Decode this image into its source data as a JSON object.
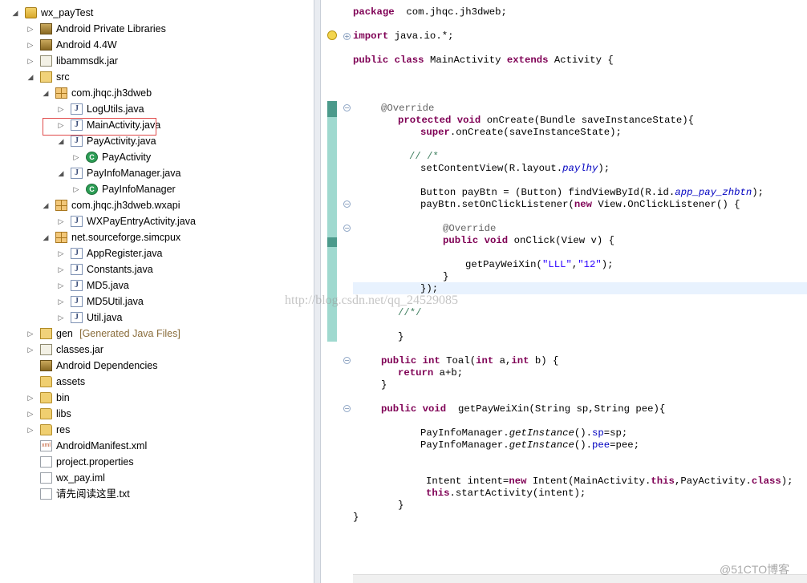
{
  "tree": {
    "items": [
      {
        "label": "wx_payTest",
        "suffix": "",
        "icon": "project-icon",
        "arrow": "expanded"
      },
      {
        "label": "Android Private Libraries",
        "suffix": "",
        "icon": "library-icon",
        "arrow": "collapsed"
      },
      {
        "label": "Android 4.4W",
        "suffix": "",
        "icon": "library-icon",
        "arrow": "collapsed"
      },
      {
        "label": "libammsdk.jar",
        "suffix": "",
        "icon": "jar-icon",
        "arrow": "collapsed"
      },
      {
        "label": "src",
        "suffix": "",
        "icon": "source-folder-icon",
        "arrow": "expanded"
      },
      {
        "label": "com.jhqc.jh3dweb",
        "suffix": "",
        "icon": "package-icon",
        "arrow": "expanded"
      },
      {
        "label": "LogUtils.java",
        "suffix": "",
        "icon": "java-file-icon",
        "arrow": "collapsed"
      },
      {
        "label": "MainActivity.java",
        "suffix": "",
        "icon": "java-file-icon",
        "arrow": "collapsed"
      },
      {
        "label": "PayActivity.java",
        "suffix": "",
        "icon": "java-file-icon",
        "arrow": "expanded"
      },
      {
        "label": "PayActivity",
        "suffix": "",
        "icon": "class-icon",
        "arrow": "collapsed"
      },
      {
        "label": "PayInfoManager.java",
        "suffix": "",
        "icon": "java-file-icon",
        "arrow": "expanded"
      },
      {
        "label": "PayInfoManager",
        "suffix": "",
        "icon": "class-icon",
        "arrow": "collapsed"
      },
      {
        "label": "com.jhqc.jh3dweb.wxapi",
        "suffix": "",
        "icon": "package-icon",
        "arrow": "expanded"
      },
      {
        "label": "WXPayEntryActivity.java",
        "suffix": "",
        "icon": "java-file-icon",
        "arrow": "collapsed"
      },
      {
        "label": "net.sourceforge.simcpux",
        "suffix": "",
        "icon": "package-icon",
        "arrow": "expanded"
      },
      {
        "label": "AppRegister.java",
        "suffix": "",
        "icon": "java-file-icon",
        "arrow": "collapsed"
      },
      {
        "label": "Constants.java",
        "suffix": "",
        "icon": "java-file-icon",
        "arrow": "collapsed"
      },
      {
        "label": "MD5.java",
        "suffix": "",
        "icon": "java-file-icon",
        "arrow": "collapsed"
      },
      {
        "label": "MD5Util.java",
        "suffix": "",
        "icon": "java-file-icon",
        "arrow": "collapsed"
      },
      {
        "label": "Util.java",
        "suffix": "",
        "icon": "java-file-icon",
        "arrow": "collapsed"
      },
      {
        "label": "gen",
        "suffix": "[Generated Java Files]",
        "icon": "source-folder-icon",
        "arrow": "collapsed"
      },
      {
        "label": "classes.jar",
        "suffix": "",
        "icon": "jar-icon",
        "arrow": "collapsed"
      },
      {
        "label": "Android Dependencies",
        "suffix": "",
        "icon": "library-icon",
        "arrow": "none"
      },
      {
        "label": "assets",
        "suffix": "",
        "icon": "folder-icon",
        "arrow": "none"
      },
      {
        "label": "bin",
        "suffix": "",
        "icon": "folder-icon",
        "arrow": "collapsed"
      },
      {
        "label": "libs",
        "suffix": "",
        "icon": "folder-icon",
        "arrow": "collapsed"
      },
      {
        "label": "res",
        "suffix": "",
        "icon": "folder-icon",
        "arrow": "collapsed"
      },
      {
        "label": "AndroidManifest.xml",
        "suffix": "",
        "icon": "xml-file-icon",
        "arrow": "none"
      },
      {
        "label": "project.properties",
        "suffix": "",
        "icon": "file-icon",
        "arrow": "none"
      },
      {
        "label": "wx_pay.iml",
        "suffix": "",
        "icon": "file-icon",
        "arrow": "none"
      },
      {
        "label": "请先阅读这里.txt",
        "suffix": "",
        "icon": "file-icon",
        "arrow": "none"
      }
    ]
  },
  "editor": {
    "lines": [
      {
        "segs": [
          [
            "kw",
            "package"
          ],
          [
            "",
            "  com.jhqc.jh3dweb;"
          ]
        ]
      },
      {
        "segs": [
          [
            "kw",
            "import"
          ],
          [
            "",
            " java.io.*;"
          ]
        ]
      },
      {
        "segs": [
          [
            "kw",
            "public class"
          ],
          [
            "",
            " MainActivity "
          ],
          [
            "kw",
            "extends"
          ],
          [
            "",
            " Activity {"
          ]
        ]
      },
      {
        "segs": [
          [
            "ann",
            "@Override"
          ]
        ]
      },
      {
        "segs": [
          [
            "kw",
            "protected void"
          ],
          [
            "",
            " onCreate(Bundle saveInstanceState){"
          ]
        ]
      },
      {
        "segs": [
          [
            "kw",
            "super"
          ],
          [
            "",
            ".onCreate(saveInstanceState);"
          ]
        ]
      },
      {
        "segs": [
          [
            "cm",
            "// /*"
          ]
        ]
      },
      {
        "segs": [
          [
            "",
            "setContentView(R.layout."
          ],
          [
            "it",
            "paylhy"
          ],
          [
            "",
            ");"
          ]
        ]
      },
      {
        "segs": [
          [
            "",
            "Button payBtn = (Button) findViewById(R.id."
          ],
          [
            "it",
            "app_pay_zhbtn"
          ],
          [
            "",
            ");"
          ]
        ]
      },
      {
        "segs": [
          [
            "",
            "payBtn.setOnClickListener("
          ],
          [
            "kw",
            "new"
          ],
          [
            "",
            " View.OnClickListener() {"
          ]
        ]
      },
      {
        "segs": [
          [
            "ann",
            "@Override"
          ]
        ]
      },
      {
        "segs": [
          [
            "kw",
            "public void"
          ],
          [
            "",
            " onClick(View v) {"
          ]
        ]
      },
      {
        "segs": [
          [
            "",
            "getPayWeiXin("
          ],
          [
            "st",
            "\"LLL\""
          ],
          [
            "",
            ","
          ],
          [
            "st",
            "\"12\""
          ],
          [
            "",
            ");"
          ]
        ]
      },
      {
        "segs": [
          [
            "",
            "}"
          ]
        ]
      },
      {
        "segs": [
          [
            "",
            "});"
          ]
        ]
      },
      {
        "segs": [
          [
            "cm",
            "//*/"
          ]
        ]
      },
      {
        "segs": [
          [
            "",
            "}"
          ]
        ]
      },
      {
        "segs": [
          [
            "kw",
            "public int"
          ],
          [
            "",
            " Toal("
          ],
          [
            "kw",
            "int"
          ],
          [
            "",
            " a,"
          ],
          [
            "kw",
            "int"
          ],
          [
            "",
            " b) {"
          ]
        ]
      },
      {
        "segs": [
          [
            "kw",
            "return"
          ],
          [
            "",
            " a+b;"
          ]
        ]
      },
      {
        "segs": [
          [
            "",
            "}"
          ]
        ]
      },
      {
        "segs": [
          [
            "kw",
            "public void"
          ],
          [
            "",
            "  getPayWeiXin(String sp,String pee){"
          ]
        ]
      },
      {
        "segs": [
          [
            "",
            "PayInfoManager."
          ],
          [
            "ital",
            "getInstance"
          ],
          [
            "",
            "()."
          ],
          [
            "fi",
            "sp"
          ],
          [
            "",
            "=sp;"
          ]
        ]
      },
      {
        "segs": [
          [
            "",
            "PayInfoManager."
          ],
          [
            "ital",
            "getInstance"
          ],
          [
            "",
            "()."
          ],
          [
            "fi",
            "pee"
          ],
          [
            "",
            "=pee;"
          ]
        ]
      },
      {
        "segs": [
          [
            "",
            "Intent intent="
          ],
          [
            "kw",
            "new"
          ],
          [
            "",
            " Intent(MainActivity."
          ],
          [
            "kw",
            "this"
          ],
          [
            "",
            ",PayActivity."
          ],
          [
            "kw",
            "class"
          ],
          [
            "",
            ");"
          ]
        ]
      },
      {
        "segs": [
          [
            "kw",
            "this"
          ],
          [
            "",
            ".startActivity(intent);"
          ]
        ]
      },
      {
        "segs": [
          [
            "",
            "}"
          ]
        ]
      },
      {
        "segs": [
          [
            "",
            "}"
          ]
        ]
      }
    ]
  },
  "watermark": "http://blog.csdn.net/qq_24529085",
  "corner_watermark": "@51CTO博客",
  "colors": {
    "keyword": "#7f0055",
    "annotation": "#646464",
    "comment": "#3f7f5f",
    "string": "#2a00ff",
    "field": "#0000c0",
    "highlight_box": "#e04b4b"
  }
}
